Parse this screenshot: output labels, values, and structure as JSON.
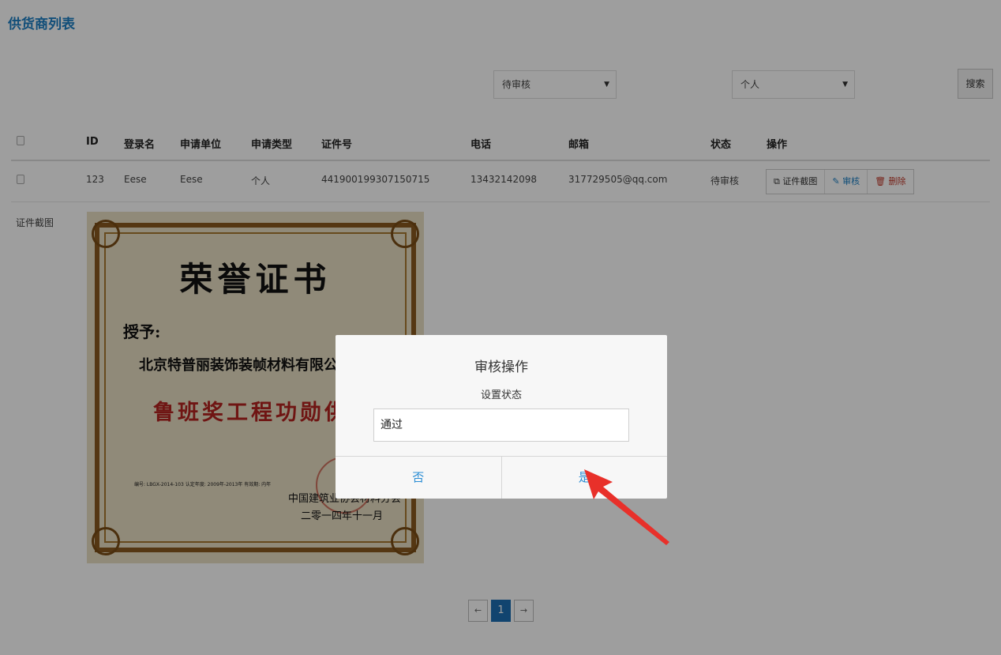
{
  "page": {
    "title": "供货商列表"
  },
  "filters": {
    "status_select": "待审核",
    "type_select": "个人",
    "search_label": "搜索"
  },
  "table": {
    "headers": [
      "ID",
      "登录名",
      "申请单位",
      "申请类型",
      "证件号",
      "电话",
      "邮箱",
      "状态",
      "操作"
    ],
    "rows": [
      {
        "id": "123",
        "login": "Eese",
        "unit": "Eese",
        "type": "个人",
        "id_number": "441900199307150715",
        "phone": "13432142098",
        "email": "317729505@qq.com",
        "status": "待审核",
        "actions": {
          "cert": "证件截图",
          "cert_icon": "copy-icon",
          "audit": "审核",
          "audit_icon": "edit-icon",
          "delete": "删除",
          "delete_icon": "trash-icon"
        }
      }
    ]
  },
  "certificate": {
    "label": "证件截图",
    "title": "荣誉证书",
    "grant": "授予:",
    "company": "北京特普丽装饰装帧材料有限公司",
    "award": "鲁班奖工程功勋供应",
    "number_line": "编号: LBGX-2014-103  认定年度: 2009年-2013年  有效期: 内年",
    "issuer": "中国建筑业协会材料分会",
    "date": "二零一四年十一月"
  },
  "pagination": {
    "prev": "←",
    "current": "1",
    "next": "→"
  },
  "modal": {
    "title": "审核操作",
    "subtitle": "设置状态",
    "input_value": "通过",
    "no_label": "否",
    "yes_label": "是"
  },
  "colors": {
    "accent": "#1c7fc4",
    "delete": "#c0392b",
    "annotation_arrow": "#e8302a"
  }
}
